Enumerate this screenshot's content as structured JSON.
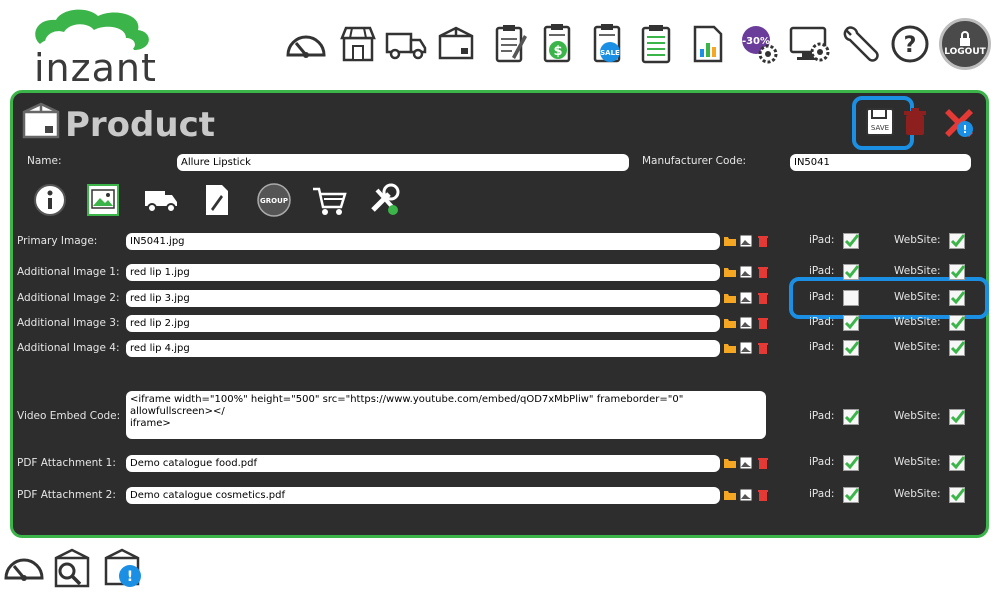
{
  "brand": {
    "name": "inzant"
  },
  "header": {
    "logout_label": "LOGOUT",
    "icons": [
      "dashboard-icon",
      "store-icon",
      "delivery-truck-icon",
      "product-box-icon",
      "order-notes-icon",
      "invoice-icon",
      "sale-catalog-icon",
      "price-list-icon",
      "reports-icon",
      "discount-settings-icon",
      "system-settings-icon",
      "tools-icon",
      "help-icon"
    ],
    "discount_badge": "-30%",
    "sale_badge": "SALE"
  },
  "page": {
    "title": "Product",
    "save_label": "SAVE",
    "name_label": "Name:",
    "name_value": "Allure Lipstick",
    "mfr_label": "Manufacturer Code:",
    "mfr_value": "IN5041",
    "tab_group_label": "GROUP"
  },
  "rows": [
    {
      "label": "Primary Image:",
      "value": "IN5041.jpg",
      "ipad": true,
      "website": true,
      "ipad_label": "iPad:",
      "web_label": "WebSite:"
    },
    {
      "label": "Additional Image 1:",
      "value": "red lip 1.jpg",
      "ipad": true,
      "website": true,
      "ipad_label": "iPad:",
      "web_label": "WebSite:"
    },
    {
      "label": "Additional Image 2:",
      "value": "red lip 3.jpg",
      "ipad": false,
      "website": true,
      "ipad_label": "iPad:",
      "web_label": "WebSite:"
    },
    {
      "label": "Additional Image 3:",
      "value": "red lip 2.jpg",
      "ipad": true,
      "website": true,
      "ipad_label": "iPad:",
      "web_label": "WebSite:"
    },
    {
      "label": "Additional Image 4:",
      "value": "red lip 4.jpg",
      "ipad": true,
      "website": true,
      "ipad_label": "iPad:",
      "web_label": "WebSite:"
    },
    {
      "label": "Video Embed Code:",
      "value": "<iframe width=\"100%\" height=\"500\" src=\"https://www.youtube.com/embed/qOD7xMbPliw\" frameborder=\"0\" allowfullscreen></\niframe>",
      "ipad": true,
      "website": true,
      "ipad_label": "iPad:",
      "web_label": "WebSite:"
    },
    {
      "label": "PDF Attachment 1:",
      "value": "Demo catalogue food.pdf",
      "ipad": true,
      "website": true,
      "ipad_label": "iPad:",
      "web_label": "WebSite:"
    },
    {
      "label": "PDF Attachment 2:",
      "value": "Demo catalogue cosmetics.pdf",
      "ipad": true,
      "website": true,
      "ipad_label": "iPad:",
      "web_label": "WebSite:"
    }
  ],
  "colors": {
    "accent_green": "#3bb44a",
    "panel_bg": "#2d2d2d",
    "highlight_blue": "#1a8fe3",
    "delete_red": "#e53935",
    "folder_orange": "#f5a623"
  }
}
